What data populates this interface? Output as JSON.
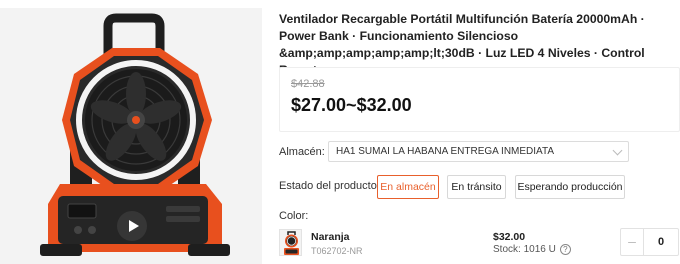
{
  "product": {
    "title": "Ventilador Recargable Portátil Multifunción Batería 20000mAh · Power Bank · Funcionamiento Silencioso &amp;amp;amp;amp;amp;lt;30dB · Luz LED 4 Niveles · Control Remoto",
    "old_price": "$42.88",
    "price_range": "$27.00~$32.00",
    "image_icon": "fan-product-photo",
    "video_icon": "play-icon"
  },
  "warehouse": {
    "label": "Almacén:",
    "selected": "HA1 SUMAI LA HABANA ENTREGA INMEDIATA"
  },
  "status": {
    "label": "Estado del producto:",
    "options": [
      "En almacén",
      "En tránsito",
      "Esperando producción"
    ],
    "active": "En almacén"
  },
  "color": {
    "label": "Color:",
    "variant": {
      "name": "Naranja",
      "code": "T062702-NR",
      "price": "$32.00",
      "stock": "Stock: 1016 U",
      "help_symbol": "?",
      "quantity": "0",
      "minus_symbol": "–"
    }
  },
  "colors": {
    "accent": "#e8602c",
    "fan_body": "#e8501e",
    "fan_dark": "#262626"
  }
}
